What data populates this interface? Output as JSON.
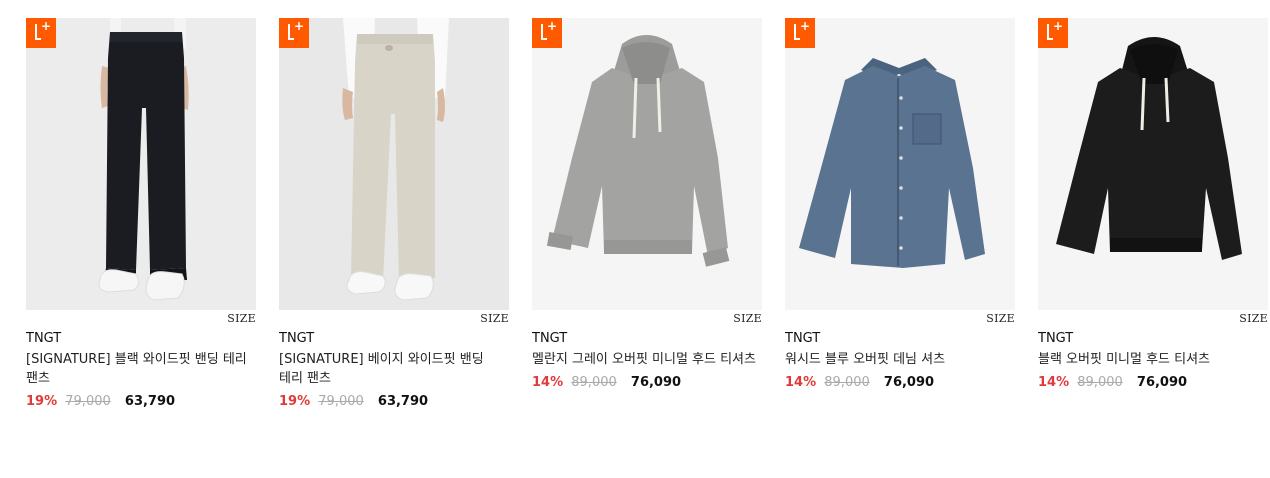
{
  "products": [
    {
      "brand": "TNGT",
      "name": "[SIGNATURE] 블랙 와이드핏 밴딩 테리 팬츠",
      "discount": "19%",
      "original_price": "79,000",
      "price": "63,790",
      "size_label": "SIZE",
      "badge": "L+",
      "image": "black-pants-model"
    },
    {
      "brand": "TNGT",
      "name": "[SIGNATURE] 베이지 와이드핏 밴딩 테리 팬츠",
      "discount": "19%",
      "original_price": "79,000",
      "price": "63,790",
      "size_label": "SIZE",
      "badge": "L+",
      "image": "beige-pants-model"
    },
    {
      "brand": "TNGT",
      "name": "멜란지 그레이 오버핏 미니멀 후드 티셔츠",
      "discount": "14%",
      "original_price": "89,000",
      "price": "76,090",
      "size_label": "SIZE",
      "badge": "L+",
      "image": "grey-hoodie"
    },
    {
      "brand": "TNGT",
      "name": "워시드 블루 오버핏 데님 셔츠",
      "discount": "14%",
      "original_price": "89,000",
      "price": "76,090",
      "size_label": "SIZE",
      "badge": "L+",
      "image": "denim-shirt"
    },
    {
      "brand": "TNGT",
      "name": "블랙 오버핏 미니멀 후드 티셔츠",
      "discount": "14%",
      "original_price": "89,000",
      "price": "76,090",
      "size_label": "SIZE",
      "badge": "L+",
      "image": "black-hoodie"
    }
  ],
  "colors": {
    "badge": "#ff5a00",
    "discount": "#e03a3a",
    "strike": "#aaaaaa"
  }
}
